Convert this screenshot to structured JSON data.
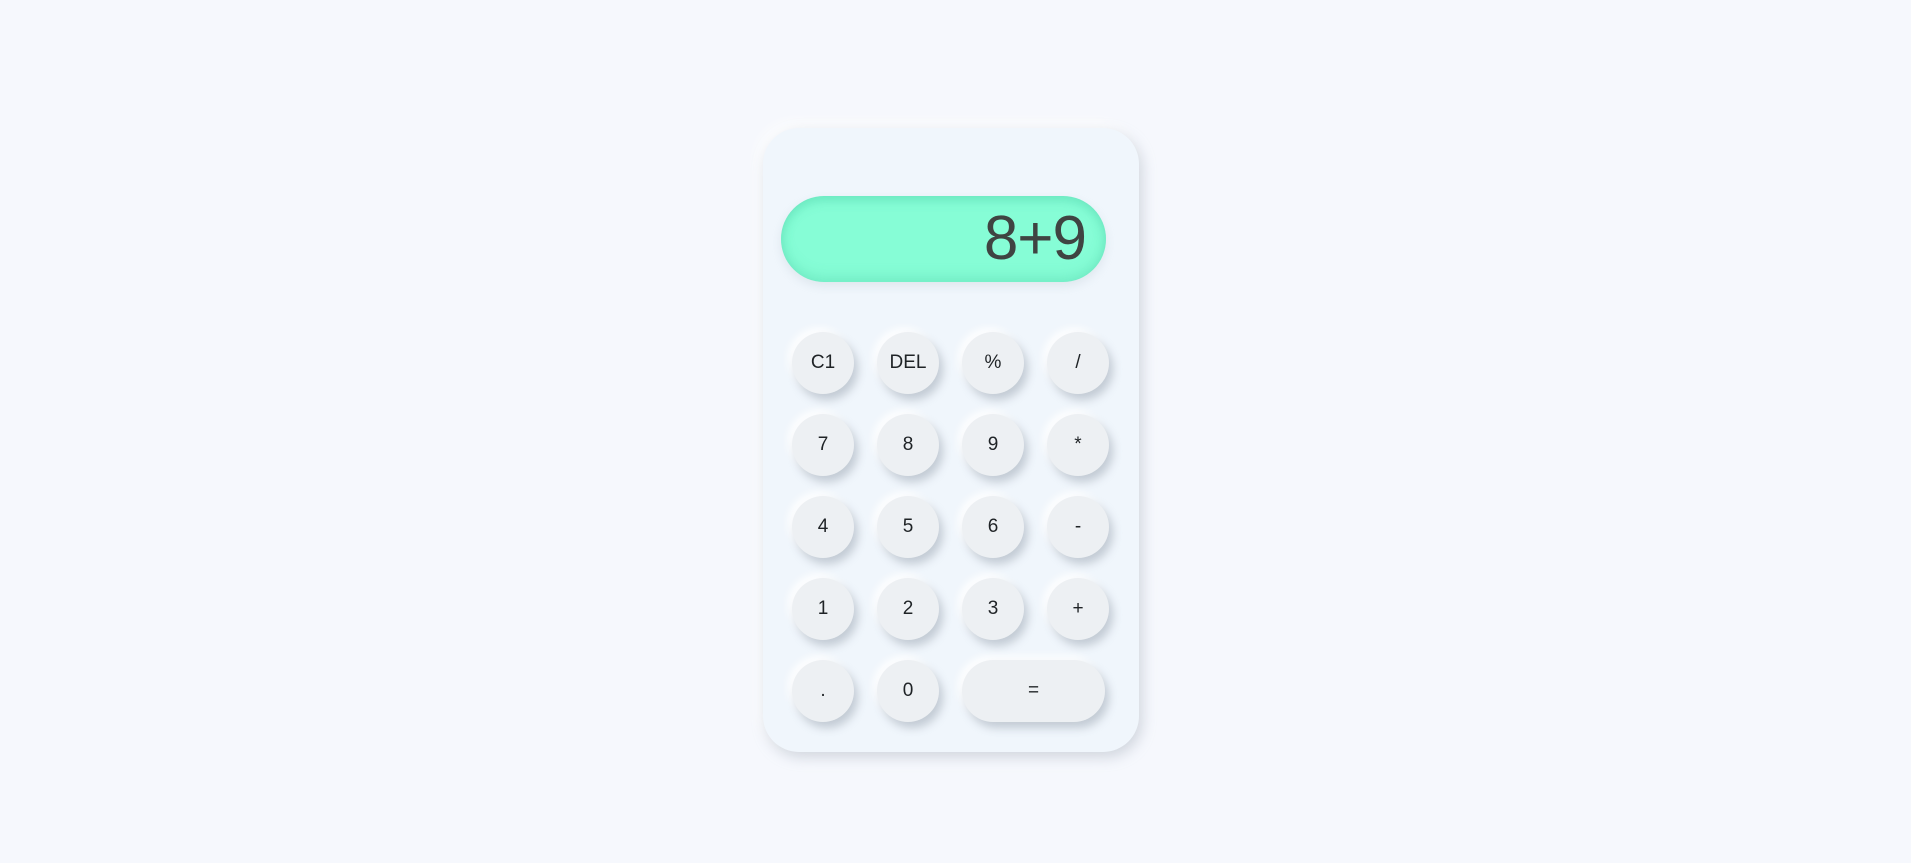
{
  "display": {
    "expression": "8+9"
  },
  "keys": {
    "clear": "C1",
    "delete": "DEL",
    "percent": "%",
    "divide": "/",
    "seven": "7",
    "eight": "8",
    "nine": "9",
    "multiply": "*",
    "four": "4",
    "five": "5",
    "six": "6",
    "subtract": "-",
    "one": "1",
    "two": "2",
    "three": "3",
    "add": "+",
    "decimal": ".",
    "zero": "0",
    "equals": "="
  },
  "colors": {
    "background": "#f6f8fd",
    "panel": "#f0f6fc",
    "display": "#86fdd6",
    "key": "#edf0f3",
    "display_text": "#3f4442"
  }
}
